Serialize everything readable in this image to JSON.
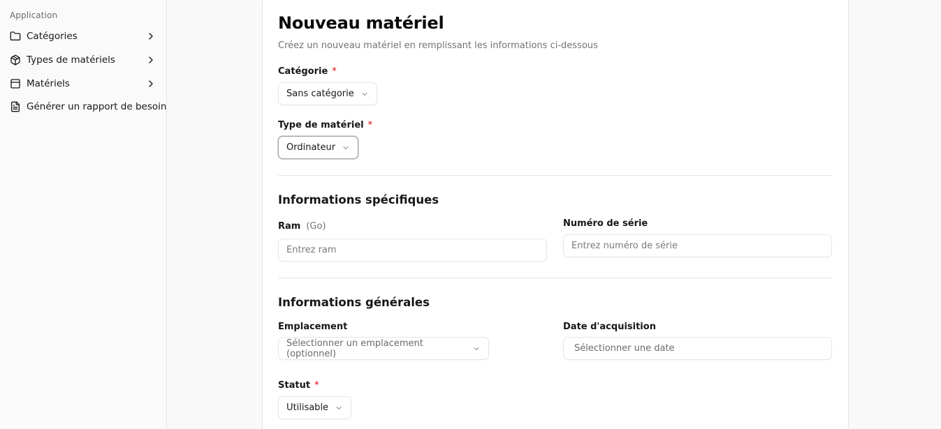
{
  "sidebar": {
    "group_label": "Application",
    "items": [
      {
        "label": "Catégories",
        "icon": "folder-icon",
        "has_chevron": true
      },
      {
        "label": "Types de matériels",
        "icon": "package-icon",
        "has_chevron": true
      },
      {
        "label": "Matériels",
        "icon": "box-icon",
        "has_chevron": true
      },
      {
        "label": "Générer un rapport de besoin",
        "icon": "file-text-icon",
        "has_chevron": false
      }
    ]
  },
  "form": {
    "title": "Nouveau matériel",
    "subtitle": "Créez un nouveau matériel en remplissant les informations ci-dessous",
    "required_mark": "*",
    "categorie": {
      "label": "Catégorie",
      "value": "Sans catégorie"
    },
    "type_materiel": {
      "label": "Type de matériel",
      "value": "Ordinateur"
    },
    "specific_section": {
      "title": "Informations spécifiques",
      "ram": {
        "label": "Ram",
        "unit": "(Go)",
        "placeholder": "Entrez ram"
      },
      "numero_serie": {
        "label": "Numéro de série",
        "placeholder": "Entrez numéro de série"
      }
    },
    "general_section": {
      "title": "Informations générales",
      "emplacement": {
        "label": "Emplacement",
        "placeholder": "Sélectionner un emplacement (optionnel)"
      },
      "date_acquisition": {
        "label": "Date d'acquisition",
        "placeholder": "Sélectionner une date"
      },
      "statut": {
        "label": "Statut",
        "value": "Utilisable"
      }
    }
  },
  "colors": {
    "required": "#e7000b",
    "border": "#e5e5e5",
    "muted_text": "#737373"
  }
}
